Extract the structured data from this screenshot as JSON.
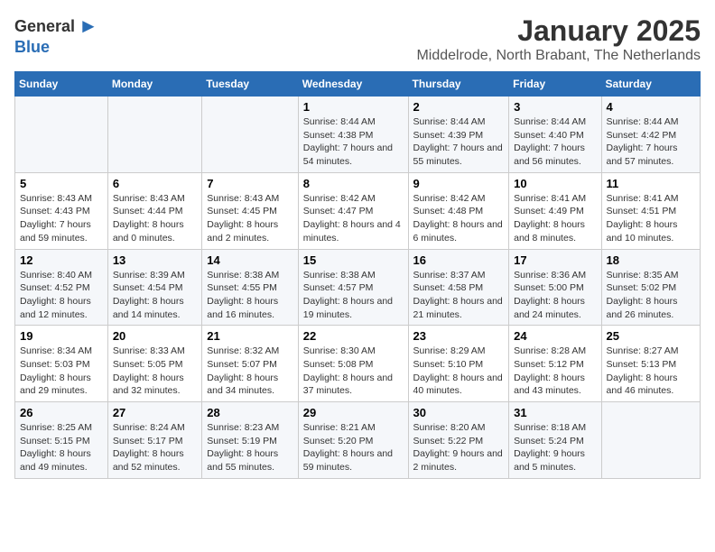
{
  "logo": {
    "general": "General",
    "blue": "Blue",
    "bird": "▶"
  },
  "title": "January 2025",
  "subtitle": "Middelrode, North Brabant, The Netherlands",
  "weekdays": [
    "Sunday",
    "Monday",
    "Tuesday",
    "Wednesday",
    "Thursday",
    "Friday",
    "Saturday"
  ],
  "weeks": [
    [
      {
        "day": "",
        "info": ""
      },
      {
        "day": "",
        "info": ""
      },
      {
        "day": "",
        "info": ""
      },
      {
        "day": "1",
        "info": "Sunrise: 8:44 AM\nSunset: 4:38 PM\nDaylight: 7 hours\nand 54 minutes."
      },
      {
        "day": "2",
        "info": "Sunrise: 8:44 AM\nSunset: 4:39 PM\nDaylight: 7 hours\nand 55 minutes."
      },
      {
        "day": "3",
        "info": "Sunrise: 8:44 AM\nSunset: 4:40 PM\nDaylight: 7 hours\nand 56 minutes."
      },
      {
        "day": "4",
        "info": "Sunrise: 8:44 AM\nSunset: 4:42 PM\nDaylight: 7 hours\nand 57 minutes."
      }
    ],
    [
      {
        "day": "5",
        "info": "Sunrise: 8:43 AM\nSunset: 4:43 PM\nDaylight: 7 hours\nand 59 minutes."
      },
      {
        "day": "6",
        "info": "Sunrise: 8:43 AM\nSunset: 4:44 PM\nDaylight: 8 hours\nand 0 minutes."
      },
      {
        "day": "7",
        "info": "Sunrise: 8:43 AM\nSunset: 4:45 PM\nDaylight: 8 hours\nand 2 minutes."
      },
      {
        "day": "8",
        "info": "Sunrise: 8:42 AM\nSunset: 4:47 PM\nDaylight: 8 hours\nand 4 minutes."
      },
      {
        "day": "9",
        "info": "Sunrise: 8:42 AM\nSunset: 4:48 PM\nDaylight: 8 hours\nand 6 minutes."
      },
      {
        "day": "10",
        "info": "Sunrise: 8:41 AM\nSunset: 4:49 PM\nDaylight: 8 hours\nand 8 minutes."
      },
      {
        "day": "11",
        "info": "Sunrise: 8:41 AM\nSunset: 4:51 PM\nDaylight: 8 hours\nand 10 minutes."
      }
    ],
    [
      {
        "day": "12",
        "info": "Sunrise: 8:40 AM\nSunset: 4:52 PM\nDaylight: 8 hours\nand 12 minutes."
      },
      {
        "day": "13",
        "info": "Sunrise: 8:39 AM\nSunset: 4:54 PM\nDaylight: 8 hours\nand 14 minutes."
      },
      {
        "day": "14",
        "info": "Sunrise: 8:38 AM\nSunset: 4:55 PM\nDaylight: 8 hours\nand 16 minutes."
      },
      {
        "day": "15",
        "info": "Sunrise: 8:38 AM\nSunset: 4:57 PM\nDaylight: 8 hours\nand 19 minutes."
      },
      {
        "day": "16",
        "info": "Sunrise: 8:37 AM\nSunset: 4:58 PM\nDaylight: 8 hours\nand 21 minutes."
      },
      {
        "day": "17",
        "info": "Sunrise: 8:36 AM\nSunset: 5:00 PM\nDaylight: 8 hours\nand 24 minutes."
      },
      {
        "day": "18",
        "info": "Sunrise: 8:35 AM\nSunset: 5:02 PM\nDaylight: 8 hours\nand 26 minutes."
      }
    ],
    [
      {
        "day": "19",
        "info": "Sunrise: 8:34 AM\nSunset: 5:03 PM\nDaylight: 8 hours\nand 29 minutes."
      },
      {
        "day": "20",
        "info": "Sunrise: 8:33 AM\nSunset: 5:05 PM\nDaylight: 8 hours\nand 32 minutes."
      },
      {
        "day": "21",
        "info": "Sunrise: 8:32 AM\nSunset: 5:07 PM\nDaylight: 8 hours\nand 34 minutes."
      },
      {
        "day": "22",
        "info": "Sunrise: 8:30 AM\nSunset: 5:08 PM\nDaylight: 8 hours\nand 37 minutes."
      },
      {
        "day": "23",
        "info": "Sunrise: 8:29 AM\nSunset: 5:10 PM\nDaylight: 8 hours\nand 40 minutes."
      },
      {
        "day": "24",
        "info": "Sunrise: 8:28 AM\nSunset: 5:12 PM\nDaylight: 8 hours\nand 43 minutes."
      },
      {
        "day": "25",
        "info": "Sunrise: 8:27 AM\nSunset: 5:13 PM\nDaylight: 8 hours\nand 46 minutes."
      }
    ],
    [
      {
        "day": "26",
        "info": "Sunrise: 8:25 AM\nSunset: 5:15 PM\nDaylight: 8 hours\nand 49 minutes."
      },
      {
        "day": "27",
        "info": "Sunrise: 8:24 AM\nSunset: 5:17 PM\nDaylight: 8 hours\nand 52 minutes."
      },
      {
        "day": "28",
        "info": "Sunrise: 8:23 AM\nSunset: 5:19 PM\nDaylight: 8 hours\nand 55 minutes."
      },
      {
        "day": "29",
        "info": "Sunrise: 8:21 AM\nSunset: 5:20 PM\nDaylight: 8 hours\nand 59 minutes."
      },
      {
        "day": "30",
        "info": "Sunrise: 8:20 AM\nSunset: 5:22 PM\nDaylight: 9 hours\nand 2 minutes."
      },
      {
        "day": "31",
        "info": "Sunrise: 8:18 AM\nSunset: 5:24 PM\nDaylight: 9 hours\nand 5 minutes."
      },
      {
        "day": "",
        "info": ""
      }
    ]
  ]
}
